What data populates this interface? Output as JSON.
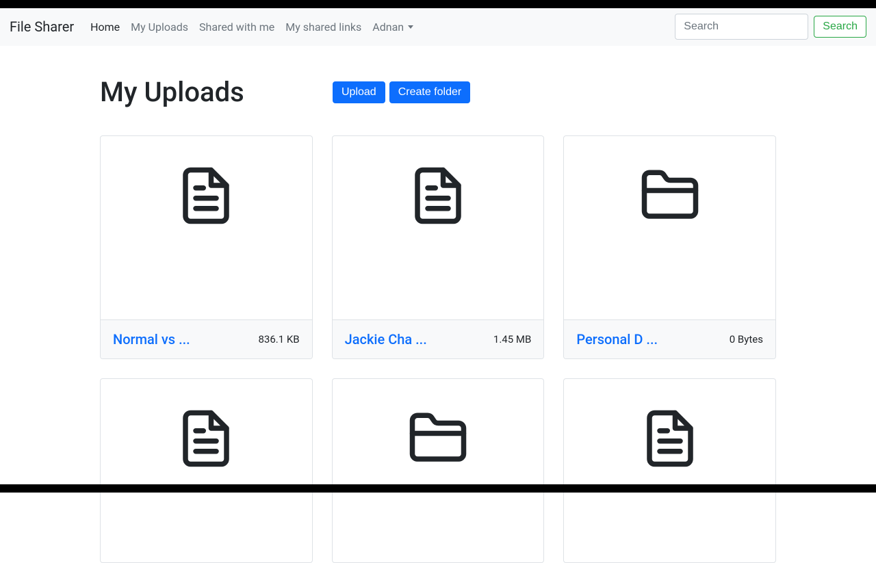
{
  "brand": "File Sharer",
  "nav": {
    "home": "Home",
    "my_uploads": "My Uploads",
    "shared_with_me": "Shared with me",
    "my_shared_links": "My shared links",
    "user": "Adnan"
  },
  "search": {
    "placeholder": "Search",
    "button": "Search"
  },
  "page": {
    "title": "My Uploads",
    "upload_button": "Upload",
    "create_folder_button": "Create folder"
  },
  "items": [
    {
      "name": "Normal vs ...",
      "size": "836.1 KB",
      "type": "file"
    },
    {
      "name": "Jackie Cha ...",
      "size": "1.45 MB",
      "type": "file"
    },
    {
      "name": "Personal D ...",
      "size": "0 Bytes",
      "type": "folder"
    },
    {
      "name": "",
      "size": "",
      "type": "file"
    },
    {
      "name": "",
      "size": "",
      "type": "folder"
    },
    {
      "name": "",
      "size": "",
      "type": "file"
    }
  ]
}
